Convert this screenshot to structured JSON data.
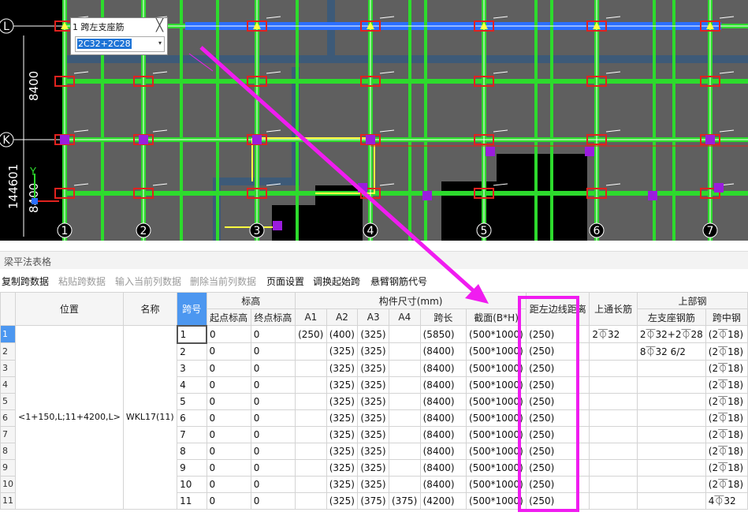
{
  "cad": {
    "axis_rows": [
      {
        "label": "L"
      },
      {
        "label": "K"
      }
    ],
    "axis_cols": [
      "1",
      "2",
      "3",
      "4",
      "5",
      "6",
      "7"
    ],
    "dim_labels": [
      "8400",
      "144601",
      "8400"
    ],
    "ucs_label": "Y",
    "popup": {
      "title": "1 跨左支座筋",
      "value": "2C32+2C28",
      "close": "╳",
      "dropdown": "▾"
    },
    "colors": {
      "beam": "#2ddb2d",
      "slab": "#5f5f5f",
      "column": "#9b1cde",
      "rebar": "#e0221e",
      "axis": "#ffffff",
      "highlight": "#f01cf0"
    }
  },
  "panel": {
    "title": "梁平法表格"
  },
  "toolbar": {
    "copy": "复制跨数据",
    "paste": "粘贴跨数据",
    "input_col": "输入当前列数据",
    "delete_col": "删除当前列数据",
    "page_setup": "页面设置",
    "swap_start": "调换起始跨",
    "cantilever": "悬臂钢筋代号"
  },
  "table": {
    "headers": {
      "position": "位置",
      "name": "名称",
      "span_no": "跨号",
      "elevation": "标高",
      "start_elev": "起点标高",
      "end_elev": "终点标高",
      "member_size": "构件尺寸(mm)",
      "a1": "A1",
      "a2": "A2",
      "a3": "A3",
      "a4": "A4",
      "span_len": "跨长",
      "section": "截面(B*H)",
      "edge_dist": "距左边线距离",
      "top_through": "上通长筋",
      "top_rebar": "上部钢",
      "left_support": "左支座钢筋",
      "mid_span": "跨中钢"
    },
    "position_value": "<1+150,L;11+4200,L>",
    "name_value": "WKL17(11)",
    "rows": [
      {
        "rn": "1",
        "span": "1",
        "s": "0",
        "e": "0",
        "a1": "(250)",
        "a2": "(400)",
        "a3": "(325)",
        "a4": "",
        "len": "(5850)",
        "sec": "(500*1000)",
        "dist": "(250)",
        "through": "2⏁32",
        "left": "2⏁32+2⏁28",
        "mid": "(2⏁18)"
      },
      {
        "rn": "2",
        "span": "2",
        "s": "0",
        "e": "0",
        "a1": "",
        "a2": "(325)",
        "a3": "(325)",
        "a4": "",
        "len": "(8400)",
        "sec": "(500*1000)",
        "dist": "(250)",
        "through": "",
        "left": "8⏁32 6/2",
        "mid": "(2⏁18)"
      },
      {
        "rn": "3",
        "span": "3",
        "s": "0",
        "e": "0",
        "a1": "",
        "a2": "(325)",
        "a3": "(325)",
        "a4": "",
        "len": "(8400)",
        "sec": "(500*1000)",
        "dist": "(250)",
        "through": "",
        "left": "",
        "mid": "(2⏁18)"
      },
      {
        "rn": "4",
        "span": "4",
        "s": "0",
        "e": "0",
        "a1": "",
        "a2": "(325)",
        "a3": "(325)",
        "a4": "",
        "len": "(8400)",
        "sec": "(500*1000)",
        "dist": "(250)",
        "through": "",
        "left": "",
        "mid": "(2⏁18)"
      },
      {
        "rn": "5",
        "span": "5",
        "s": "0",
        "e": "0",
        "a1": "",
        "a2": "(325)",
        "a3": "(325)",
        "a4": "",
        "len": "(8400)",
        "sec": "(500*1000)",
        "dist": "(250)",
        "through": "",
        "left": "",
        "mid": "(2⏁18)"
      },
      {
        "rn": "6",
        "span": "6",
        "s": "0",
        "e": "0",
        "a1": "",
        "a2": "(325)",
        "a3": "(325)",
        "a4": "",
        "len": "(8400)",
        "sec": "(500*1000)",
        "dist": "(250)",
        "through": "",
        "left": "",
        "mid": "(2⏁18)"
      },
      {
        "rn": "7",
        "span": "7",
        "s": "0",
        "e": "0",
        "a1": "",
        "a2": "(325)",
        "a3": "(325)",
        "a4": "",
        "len": "(8400)",
        "sec": "(500*1000)",
        "dist": "(250)",
        "through": "",
        "left": "",
        "mid": "(2⏁18)"
      },
      {
        "rn": "8",
        "span": "8",
        "s": "0",
        "e": "0",
        "a1": "",
        "a2": "(325)",
        "a3": "(325)",
        "a4": "",
        "len": "(8400)",
        "sec": "(500*1000)",
        "dist": "(250)",
        "through": "",
        "left": "",
        "mid": "(2⏁18)"
      },
      {
        "rn": "9",
        "span": "9",
        "s": "0",
        "e": "0",
        "a1": "",
        "a2": "(325)",
        "a3": "(325)",
        "a4": "",
        "len": "(8400)",
        "sec": "(500*1000)",
        "dist": "(250)",
        "through": "",
        "left": "",
        "mid": "(2⏁18)"
      },
      {
        "rn": "10",
        "span": "10",
        "s": "0",
        "e": "0",
        "a1": "",
        "a2": "(325)",
        "a3": "(325)",
        "a4": "",
        "len": "(8400)",
        "sec": "(500*1000)",
        "dist": "(250)",
        "through": "",
        "left": "",
        "mid": "(2⏁18)"
      },
      {
        "rn": "11",
        "span": "11",
        "s": "0",
        "e": "0",
        "a1": "",
        "a2": "(325)",
        "a3": "(375)",
        "a4": "(375)",
        "len": "(4200)",
        "sec": "(500*1000)",
        "dist": "(250)",
        "through": "",
        "left": "",
        "mid": "4⏁32"
      }
    ]
  }
}
